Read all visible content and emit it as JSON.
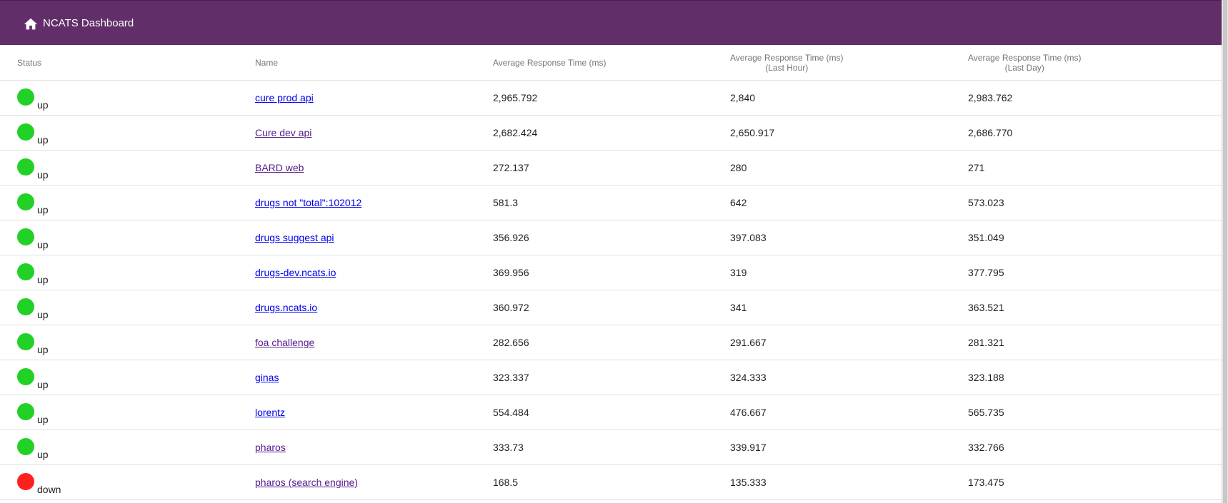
{
  "appbar": {
    "title": "NCATS Dashboard",
    "home_icon": "home-icon",
    "background": "#622e6a"
  },
  "colors": {
    "up": "#22d126",
    "down": "#ff1f1f",
    "link_unvisited": "#0000ee",
    "link_visited": "#551a8b"
  },
  "table": {
    "headers": {
      "status": "Status",
      "name": "Name",
      "avg": "Average Response Time (ms)",
      "avg_hour_line1": "Average Response Time (ms)",
      "avg_hour_line2": "(Last Hour)",
      "avg_day_line1": "Average Response Time (ms)",
      "avg_day_line2": "(Last Day)"
    },
    "rows": [
      {
        "status": "up",
        "name": "cure prod api",
        "link_state": "unvisited",
        "avg": "2,965.792",
        "hour": "2,840",
        "day": "2,983.762"
      },
      {
        "status": "up",
        "name": "Cure dev api",
        "link_state": "visited",
        "avg": "2,682.424",
        "hour": "2,650.917",
        "day": "2,686.770"
      },
      {
        "status": "up",
        "name": "BARD web",
        "link_state": "visited",
        "avg": "272.137",
        "hour": "280",
        "day": "271"
      },
      {
        "status": "up",
        "name": "drugs not \"total\":102012",
        "link_state": "unvisited",
        "avg": "581.3",
        "hour": "642",
        "day": "573.023"
      },
      {
        "status": "up",
        "name": "drugs suggest api",
        "link_state": "unvisited",
        "avg": "356.926",
        "hour": "397.083",
        "day": "351.049"
      },
      {
        "status": "up",
        "name": "drugs-dev.ncats.io",
        "link_state": "unvisited",
        "avg": "369.956",
        "hour": "319",
        "day": "377.795"
      },
      {
        "status": "up",
        "name": "drugs.ncats.io",
        "link_state": "unvisited",
        "avg": "360.972",
        "hour": "341",
        "day": "363.521"
      },
      {
        "status": "up",
        "name": "foa challenge",
        "link_state": "visited",
        "avg": "282.656",
        "hour": "291.667",
        "day": "281.321"
      },
      {
        "status": "up",
        "name": "ginas",
        "link_state": "unvisited",
        "avg": "323.337",
        "hour": "324.333",
        "day": "323.188"
      },
      {
        "status": "up",
        "name": "lorentz",
        "link_state": "unvisited",
        "avg": "554.484",
        "hour": "476.667",
        "day": "565.735"
      },
      {
        "status": "up",
        "name": "pharos",
        "link_state": "visited",
        "avg": "333.73",
        "hour": "339.917",
        "day": "332.766"
      },
      {
        "status": "down",
        "name": "pharos (search engine)",
        "link_state": "visited",
        "avg": "168.5",
        "hour": "135.333",
        "day": "173.475"
      }
    ]
  }
}
